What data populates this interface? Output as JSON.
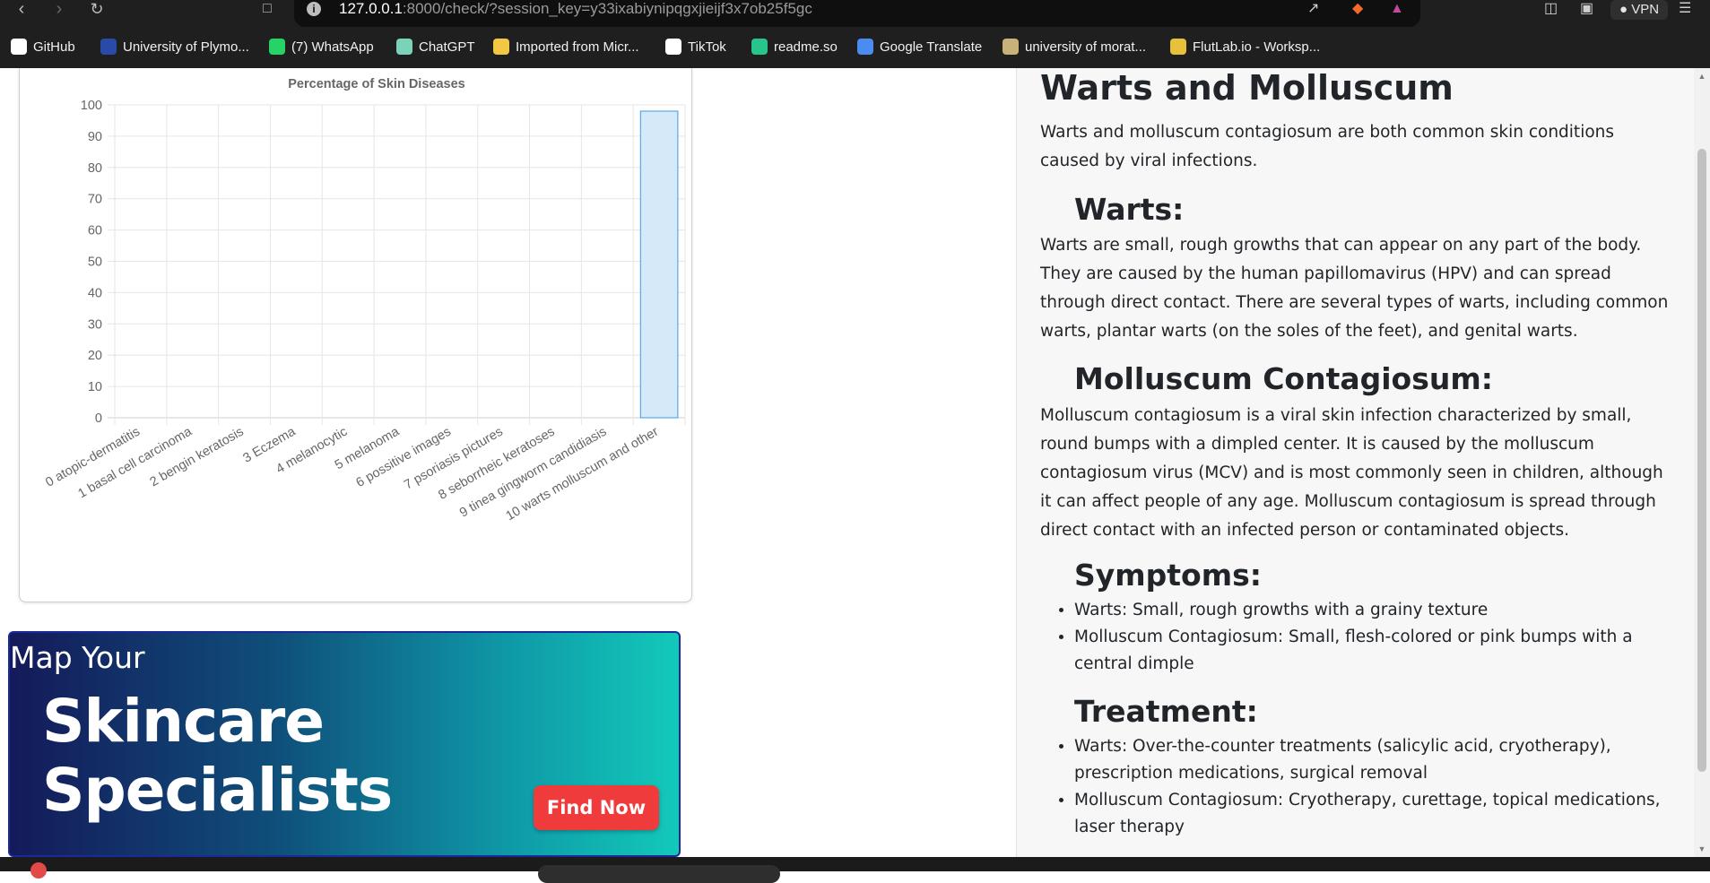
{
  "browser": {
    "url_host": "127.0.0.1",
    "url_rest": ":8000/check/?session_key=y33ixabiynipqgxjieijf3x7ob25f5gc",
    "vpn_label": "VPN",
    "bookmarks": [
      {
        "label": "GitHub",
        "icon": "github-icon",
        "color": "#ffffff"
      },
      {
        "label": "University of Plymo...",
        "icon": "shield-icon",
        "color": "#2a4aa8"
      },
      {
        "label": "(7) WhatsApp",
        "icon": "whatsapp-icon",
        "color": "#25d366"
      },
      {
        "label": "ChatGPT",
        "icon": "chatgpt-icon",
        "color": "#7ad3b8"
      },
      {
        "label": "Imported from Micr...",
        "icon": "folder-icon",
        "color": "#f2c744"
      },
      {
        "label": "TikTok",
        "icon": "tiktok-icon",
        "color": "#ffffff"
      },
      {
        "label": "readme.so",
        "icon": "readme-icon",
        "color": "#27c58b"
      },
      {
        "label": "Google Translate",
        "icon": "translate-icon",
        "color": "#4a8cf0"
      },
      {
        "label": "university of morat...",
        "icon": "crest-icon",
        "color": "#c8b27a"
      },
      {
        "label": "FlutLab.io - Worksp...",
        "icon": "flutter-icon",
        "color": "#e7c13a"
      }
    ]
  },
  "chart_data": {
    "type": "bar",
    "title": "Percentage of Skin Diseases",
    "categories": [
      "0 atopic-dermatitis",
      "1 basal cell carcinoma",
      "2 bengin keratosis",
      "3 Eczema",
      "4 melanocytic",
      "5 melanoma",
      "6 possitive images",
      "7 psoriasis pictures",
      "8 seborrheic keratoses",
      "9 tinea gingworm candidiasis",
      "10 warts molluscum and other"
    ],
    "values": [
      0,
      0,
      0,
      0,
      0,
      0,
      0,
      0,
      0,
      0,
      98
    ],
    "ylim": [
      0,
      100
    ],
    "yticks": [
      0,
      10,
      20,
      30,
      40,
      50,
      60,
      70,
      80,
      90,
      100
    ],
    "grid": true,
    "bar_fill": "#d6e9f8",
    "bar_stroke": "#3e9be6"
  },
  "banner": {
    "small_text": "Map Your",
    "big_text": "Skincare Specialists",
    "button_label": "Find Now"
  },
  "article": {
    "title": "Warts and Molluscum",
    "intro": "Warts and molluscum contagiosum are both common skin conditions caused by viral infections.",
    "warts_heading": "Warts:",
    "warts_text": "Warts are small, rough growths that can appear on any part of the body. They are caused by the human papillomavirus (HPV) and can spread through direct contact. There are several types of warts, including common warts, plantar warts (on the soles of the feet), and genital warts.",
    "molluscum_heading": "Molluscum Contagiosum:",
    "molluscum_text": "Molluscum contagiosum is a viral skin infection characterized by small, round bumps with a dimpled center. It is caused by the molluscum contagiosum virus (MCV) and is most commonly seen in children, although it can affect people of any age. Molluscum contagiosum is spread through direct contact with an infected person or contaminated objects.",
    "symptoms_heading": "Symptoms:",
    "symptoms": [
      "Warts: Small, rough growths with a grainy texture",
      "Molluscum Contagiosum: Small, flesh-colored or pink bumps with a central dimple"
    ],
    "treatment_heading": "Treatment:",
    "treatment": [
      "Warts: Over-the-counter treatments (salicylic acid, cryotherapy), prescription medications, surgical removal",
      "Molluscum Contagiosum: Cryotherapy, curettage, topical medications, laser therapy"
    ]
  }
}
